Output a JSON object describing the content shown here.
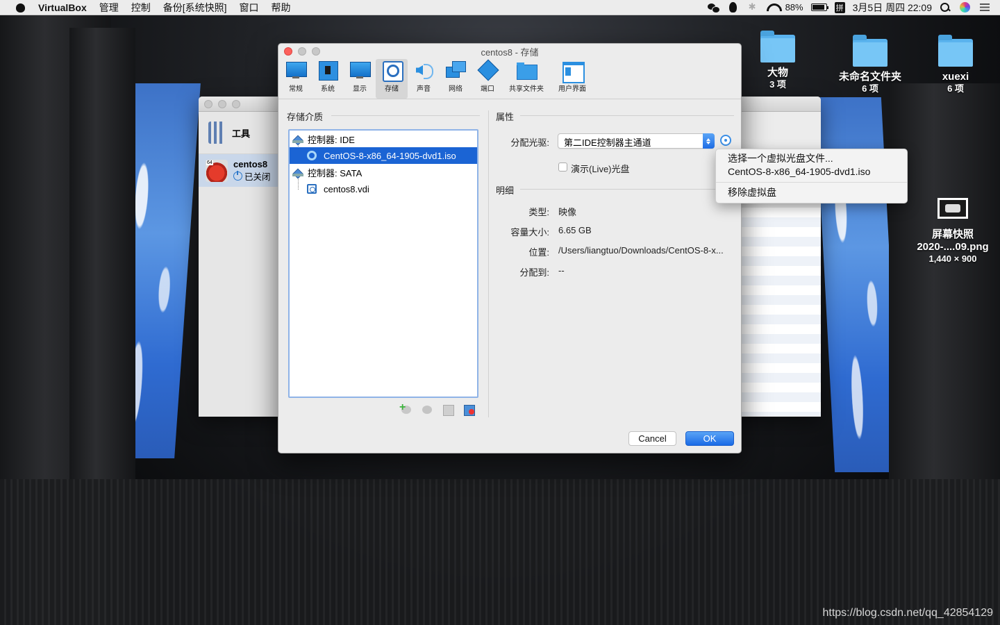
{
  "menubar": {
    "app": "VirtualBox",
    "items": [
      "管理",
      "控制",
      "备份[系统快照]",
      "窗口",
      "帮助"
    ],
    "battery": "88%",
    "input_method": "拼",
    "clock": "3月5日 周四 22:09"
  },
  "desktop": {
    "icons": [
      {
        "name": "大物",
        "sub": "3 项"
      },
      {
        "name": "未命名文件夹",
        "sub": "6 项"
      },
      {
        "name": "xuexi",
        "sub": "6 项"
      }
    ],
    "screenshot_file": {
      "name_line1": "屏幕快照",
      "name_line2": "2020-....09.png",
      "size": "1,440 × 900"
    },
    "watermark": "https://blog.csdn.net/qq_42854129"
  },
  "manager": {
    "tools_label": "工具",
    "vm_name": "centos8",
    "vm_state": "已关闭"
  },
  "dialog": {
    "title": "centos8 - 存储",
    "toolbar": [
      {
        "label": "常规",
        "icon": "general-icon"
      },
      {
        "label": "系统",
        "icon": "system-icon"
      },
      {
        "label": "显示",
        "icon": "display-icon"
      },
      {
        "label": "存储",
        "icon": "storage-icon"
      },
      {
        "label": "声音",
        "icon": "audio-icon"
      },
      {
        "label": "网络",
        "icon": "network-icon"
      },
      {
        "label": "端口",
        "icon": "ports-icon"
      },
      {
        "label": "共享文件夹",
        "icon": "shared-folder-icon"
      },
      {
        "label": "用户界面",
        "icon": "user-interface-icon"
      }
    ],
    "storage_media_label": "存储介质",
    "tree": {
      "ide_controller": "控制器: IDE",
      "iso_item": "CentOS-8-x86_64-1905-dvd1.iso",
      "sata_controller": "控制器: SATA",
      "vdi_item": "centos8.vdi"
    },
    "attributes_label": "属性",
    "optical_drive_label": "分配光驱:",
    "optical_drive_value": "第二IDE控制器主通道",
    "live_cd_label": "演示(Live)光盘",
    "details_label": "明细",
    "details": {
      "type_label": "类型:",
      "type_value": "映像",
      "size_label": "容量大小:",
      "size_value": "6.65 GB",
      "location_label": "位置:",
      "location_value": "/Users/liangtuo/Downloads/CentOS-8-x...",
      "attached_label": "分配到:",
      "attached_value": "--"
    },
    "cancel_label": "Cancel",
    "ok_label": "OK"
  },
  "popup": {
    "choose_file": "选择一个虚拟光盘文件...",
    "recent_iso": "CentOS-8-x86_64-1905-dvd1.iso",
    "remove_disk": "移除虚拟盘"
  }
}
